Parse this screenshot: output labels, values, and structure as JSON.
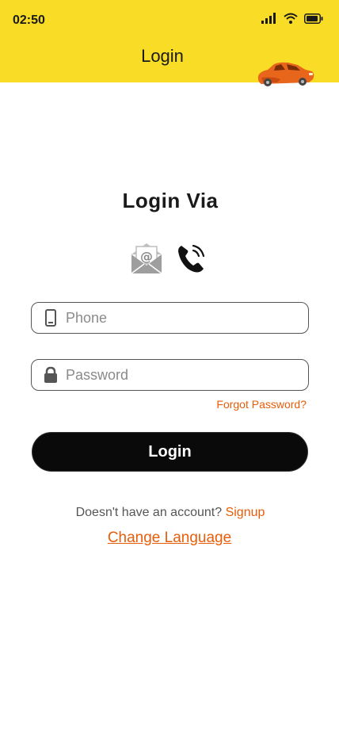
{
  "status_bar": {
    "time": "02:50"
  },
  "header": {
    "title": "Login"
  },
  "main": {
    "heading": "Login Via",
    "phone": {
      "placeholder": "Phone",
      "value": ""
    },
    "password": {
      "placeholder": "Password",
      "value": ""
    },
    "forgot_label": "Forgot Password?",
    "login_label": "Login",
    "no_account_text": "Doesn't have an account?",
    "signup_label": "Signup",
    "change_language_label": "Change Language"
  },
  "colors": {
    "header": "#f8dc25",
    "accent": "#e85d0a",
    "button": "#0a0a0a"
  },
  "icons": [
    "signal-icon",
    "wifi-icon",
    "battery-icon",
    "taxi-car-icon",
    "email-icon",
    "phone-call-icon",
    "mobile-phone-icon",
    "lock-icon"
  ]
}
